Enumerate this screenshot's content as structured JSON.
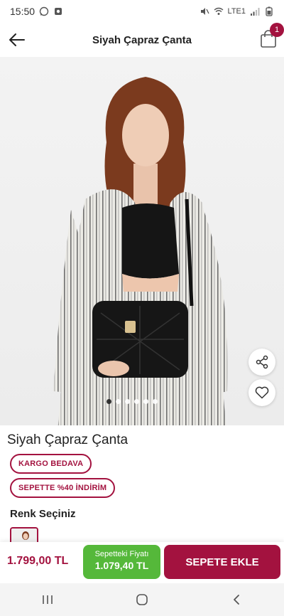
{
  "status_bar": {
    "time": "15:50",
    "network": "LTE1"
  },
  "header": {
    "title": "Siyah Çapraz Çanta",
    "cart_count": "1"
  },
  "product": {
    "name": "Siyah Çapraz Çanta"
  },
  "badges": {
    "free_shipping": "KARGO BEDAVA",
    "discount": "SEPETTE %40 İNDİRİM"
  },
  "color_section": {
    "title": "Renk Seçiniz"
  },
  "bottom_bar": {
    "price": "1.799,00 TL",
    "cart_price_label": "Sepetteki Fiyatı",
    "cart_price_value": "1.079,40 TL",
    "add_to_cart": "SEPETE EKLE"
  },
  "carousel": {
    "total": 6,
    "active": 1
  },
  "colors": {
    "brand": "#a3123f",
    "cart_price_bg": "#55b83a"
  }
}
